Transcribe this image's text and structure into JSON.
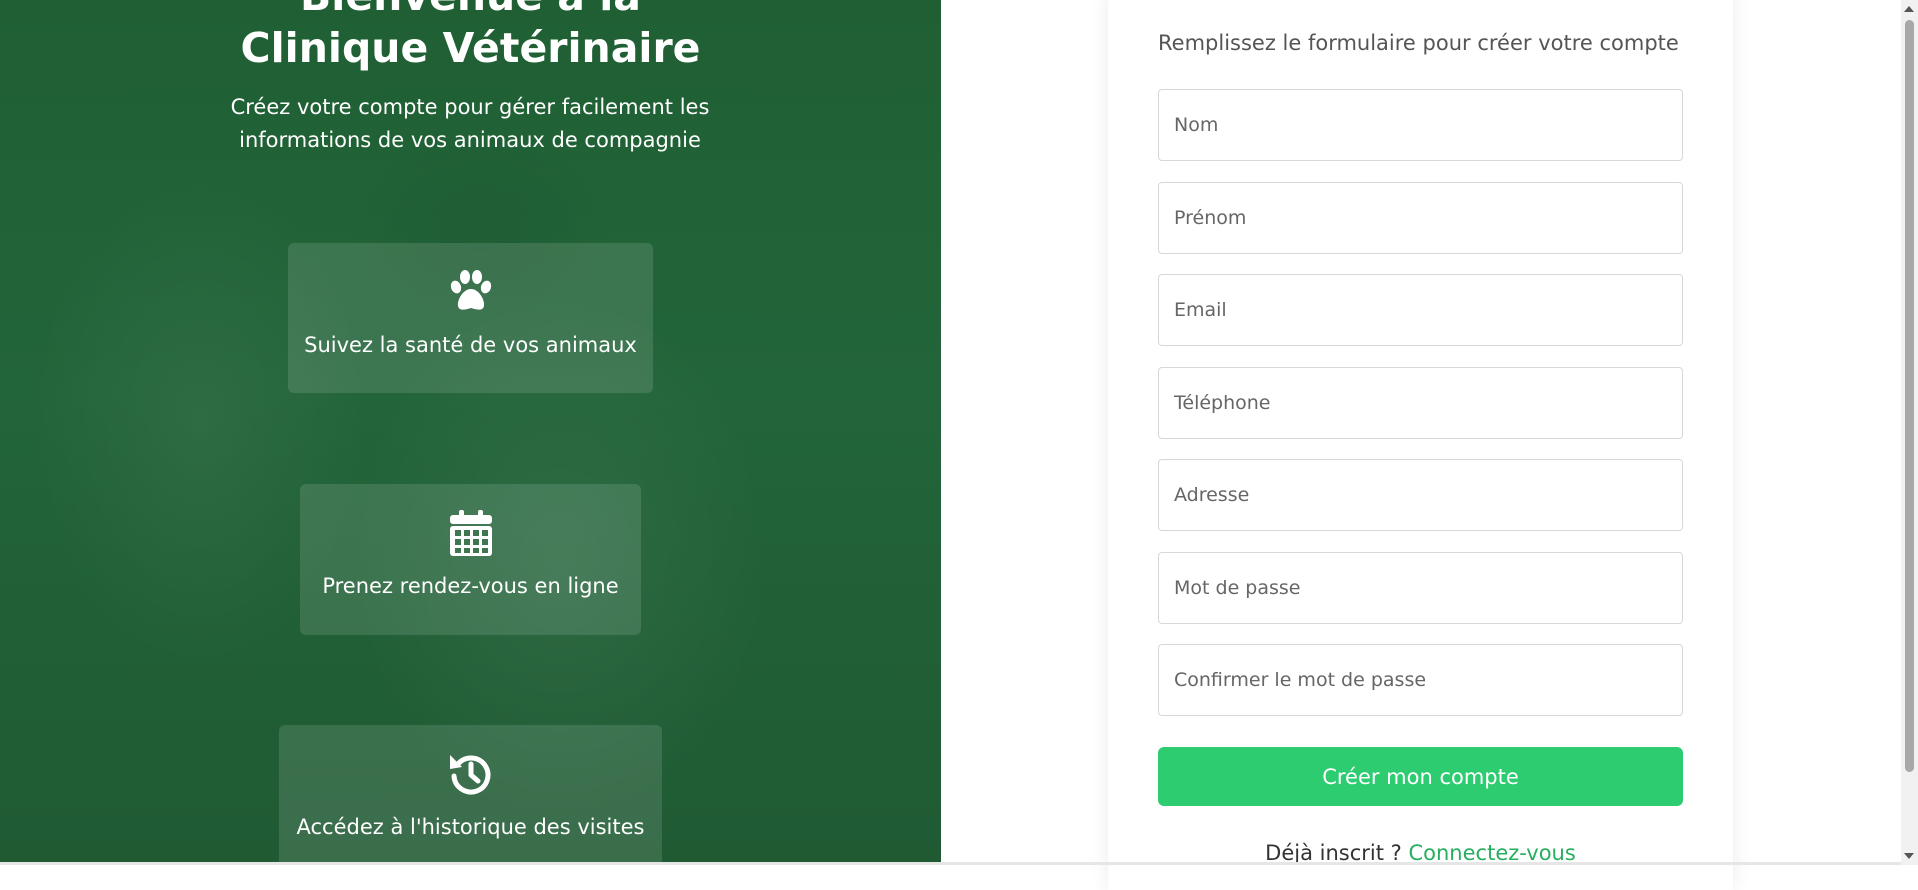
{
  "hero": {
    "title_line1": "Bienvenue à la",
    "title_line2": "Clinique Vétérinaire",
    "subtitle": "Créez votre compte pour gérer facilement les informations de vos animaux de compagnie"
  },
  "features": [
    {
      "icon": "paw-icon",
      "label": "Suivez la santé de vos animaux"
    },
    {
      "icon": "calendar-icon",
      "label": "Prenez rendez-vous en ligne"
    },
    {
      "icon": "history-icon",
      "label": "Accédez à l'historique des visites"
    }
  ],
  "form": {
    "subtitle": "Remplissez le formulaire pour créer votre compte",
    "fields": {
      "nom": "Nom",
      "prenom": "Prénom",
      "email": "Email",
      "telephone": "Téléphone",
      "adresse": "Adresse",
      "password": "Mot de passe",
      "confirm_password": "Confirmer le mot de passe"
    },
    "submit_label": "Créer mon compte",
    "login_prompt": "Déjà inscrit ?",
    "login_link": "Connectez-vous"
  },
  "colors": {
    "brand_dark_green": "#1f5f33",
    "accent_green": "#2ecc71",
    "link_green": "#27ae60"
  }
}
